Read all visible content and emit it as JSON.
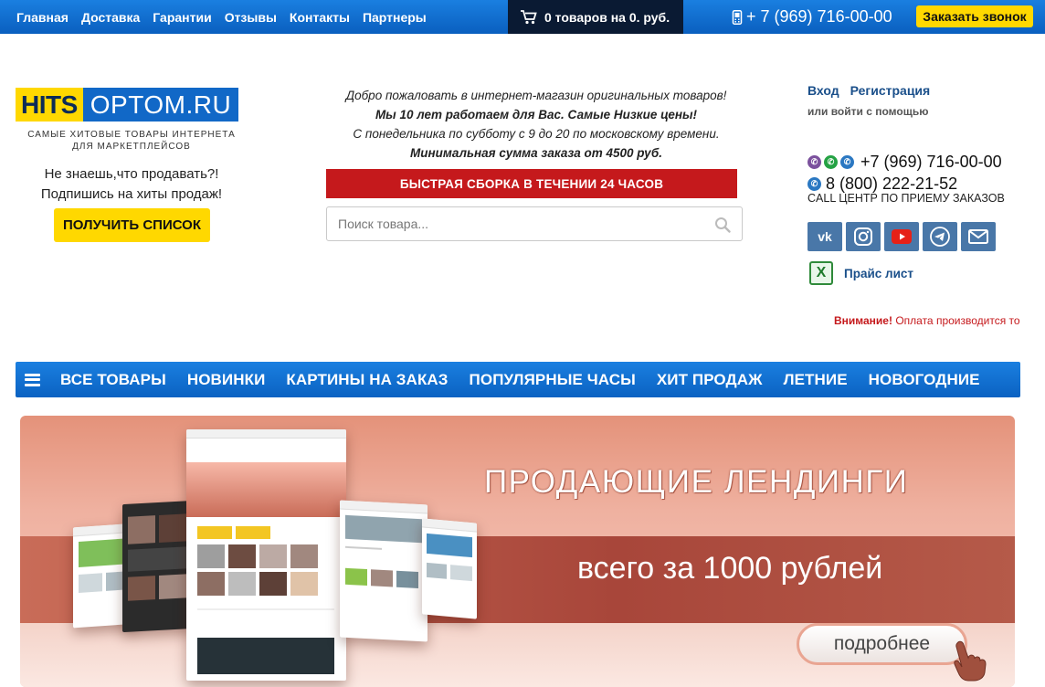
{
  "topbar": {
    "nav": [
      "Главная",
      "Доставка",
      "Гарантии",
      "Отзывы",
      "Контакты",
      "Партнеры"
    ],
    "cart_text": "0 товаров на 0. руб.",
    "phone": "+ 7 (969) 716-00-00",
    "callback_label": "Заказать звонок"
  },
  "logo": {
    "part1": "HITS",
    "part2": "OPTOM.RU",
    "tagline": "Самые хитовые товары интернета для маркетплейсов"
  },
  "promo": {
    "line1": "Не знаешь,что продавать?!",
    "line2": "Подпишись на хиты продаж!",
    "button_label": "ПОЛУЧИТЬ СПИСОК"
  },
  "welcome": {
    "line1": "Добро пожаловать в интернет-магазин оригинальных товаров!",
    "line2": "Мы 10 лет работаем для Вас. Самые Низкие цены!",
    "line3": "С понедельника по субботу с 9 до 20 по московскому времени.",
    "line4": "Минимальная сумма заказа от 4500 руб."
  },
  "fast_assembly": "БЫСТРАЯ СБОРКА В ТЕЧЕНИИ 24 ЧАСОВ",
  "search": {
    "placeholder": "Поиск товара..."
  },
  "account": {
    "login": "Вход",
    "register": "Регистрация",
    "login_via": "или войти с помощью"
  },
  "contacts": {
    "phone1": "+7 (969) 716-00-00",
    "phone2": "8 (800) 222-21-52",
    "call_center": "CALL ЦЕНТР ПО ПРИЕМУ ЗАКАЗОВ",
    "price_list": "Прайс лист"
  },
  "notice": {
    "warning": "Внимание!",
    "text": "Оплата производится то"
  },
  "main_menu": [
    "ВСЕ ТОВАРЫ",
    "НОВИНКИ",
    "КАРТИНЫ НА ЗАКАЗ",
    "ПОПУЛЯРНЫЕ ЧАСЫ",
    "ХИТ ПРОДАЖ",
    "ЛЕТНИЕ",
    "НОВОГОДНИЕ"
  ],
  "banner": {
    "title": "ПРОДАЮЩИЕ ЛЕНДИНГИ",
    "subtitle": "всего за 1000 рублей",
    "button_label": "подробнее"
  },
  "colors": {
    "brand_blue": "#1168c7",
    "accent_yellow": "#ffd800",
    "accent_red": "#c5191c",
    "dark_cart": "#0a1a33"
  }
}
